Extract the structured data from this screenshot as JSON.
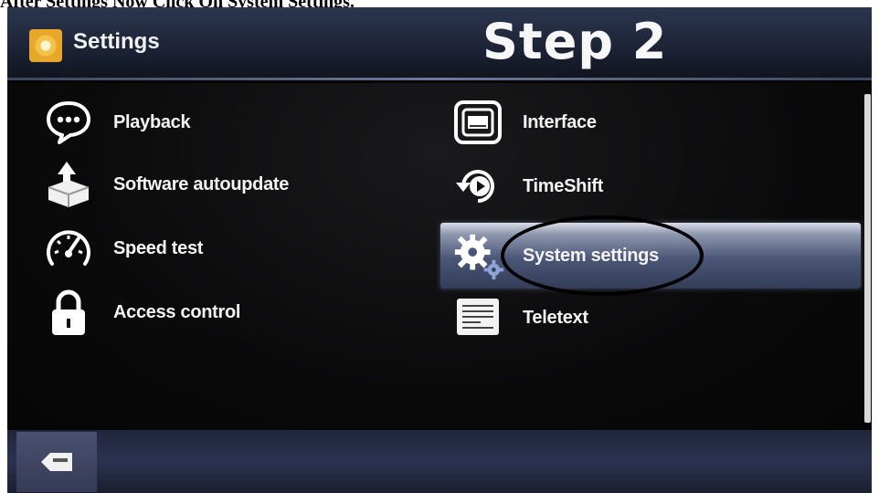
{
  "caption": "After Settings Now Click On System Settings.",
  "header": {
    "app_title": "Settings",
    "step_label": "Step 2"
  },
  "menu": {
    "playback": "Playback",
    "software_autoupdate": "Software autoupdate",
    "speed_test": "Speed test",
    "access_control": "Access control",
    "interface": "Interface",
    "timeshift": "TimeShift",
    "system_settings": "System settings",
    "teletext": "Teletext"
  },
  "footer": {
    "exit_icon": "exit-icon"
  },
  "colors": {
    "text": "#f3f3f3",
    "selection": "#4b5676",
    "header": "#1d2436"
  }
}
